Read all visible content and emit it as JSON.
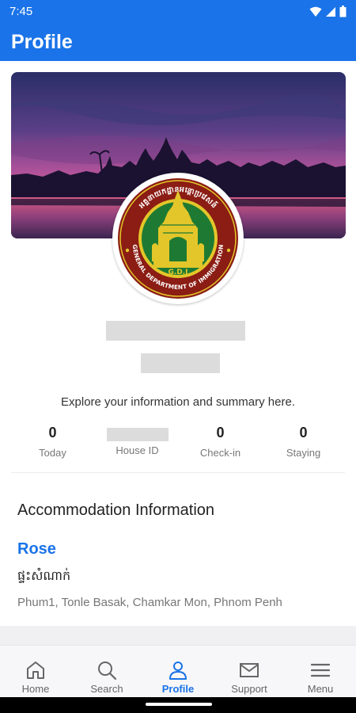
{
  "status_bar": {
    "time": "7:45"
  },
  "app_bar": {
    "title": "Profile"
  },
  "profile": {
    "summary_text": "Explore your information and summary here."
  },
  "stats": [
    {
      "value": "0",
      "label": "Today"
    },
    {
      "value": "",
      "label": "House ID"
    },
    {
      "value": "0",
      "label": "Check-in"
    },
    {
      "value": "0",
      "label": "Staying"
    }
  ],
  "accommodation": {
    "section_title": "Accommodation Information",
    "name": "Rose",
    "type": "ផ្ទះសំណាក់",
    "address": "Phum1, Tonle Basak, Chamkar Mon, Phnom Penh"
  },
  "seal": {
    "abbreviation": "G.D.I",
    "english_text": "GENERAL DEPARTMENT OF IMMIGRATION",
    "khmer_text": "អគ្គនាយកដ្ឋានអន្តោប្រវេសន៍"
  },
  "bottom_nav": {
    "items": [
      {
        "label": "Home",
        "icon": "home-icon"
      },
      {
        "label": "Search",
        "icon": "search-icon"
      },
      {
        "label": "Profile",
        "icon": "profile-icon",
        "active": true
      },
      {
        "label": "Support",
        "icon": "mail-icon"
      },
      {
        "label": "Menu",
        "icon": "menu-icon"
      }
    ]
  },
  "colors": {
    "primary": "#1a73e8",
    "seal_red": "#8b1d14",
    "seal_green": "#1e7a32",
    "seal_gold": "#e3c62a"
  }
}
